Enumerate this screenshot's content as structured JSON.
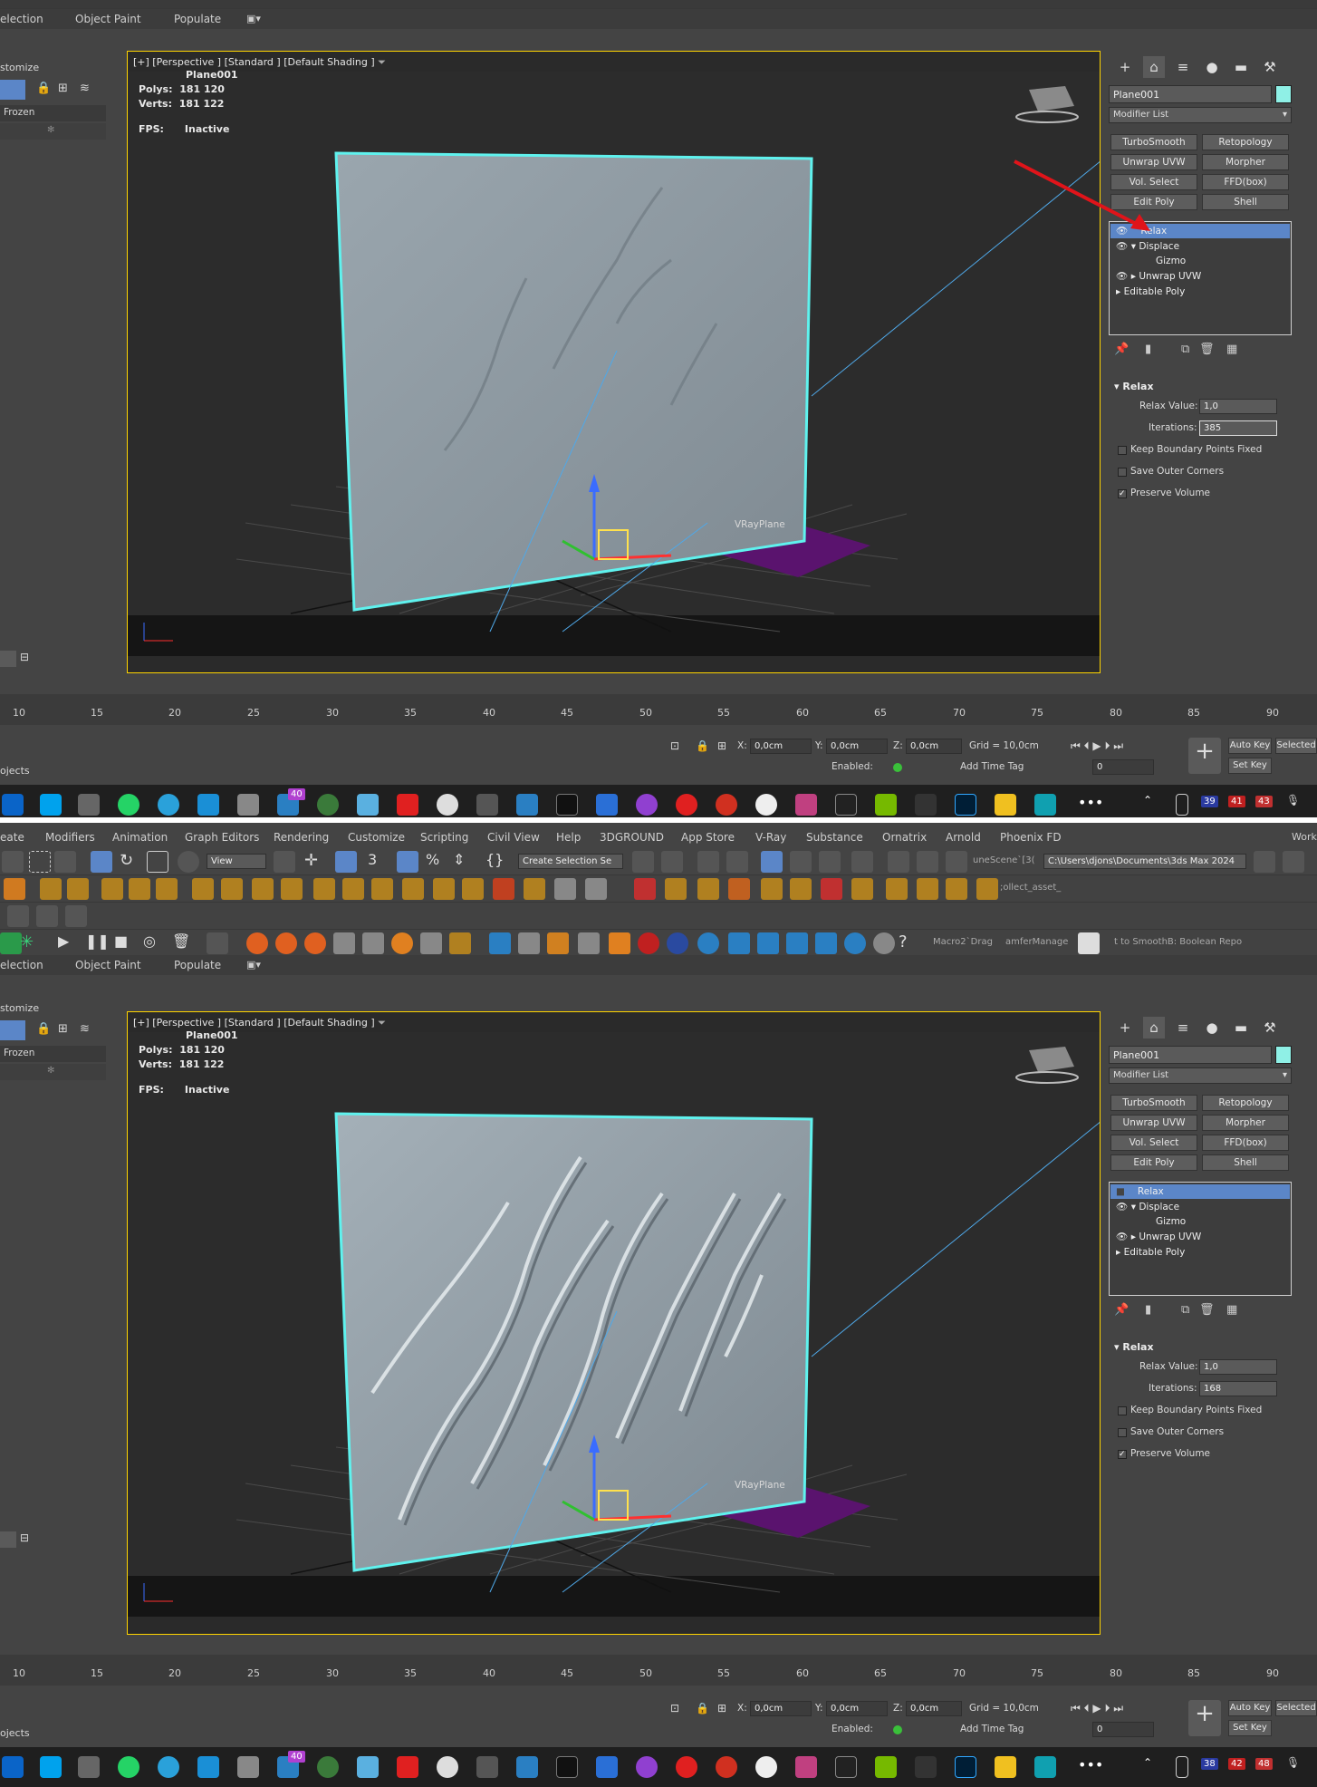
{
  "menu": [
    "eate",
    "Modifiers",
    "Animation",
    "Graph Editors",
    "Rendering",
    "Customize",
    "Scripting",
    "Civil View",
    "Help",
    "3DGROUND",
    "App Store",
    "V-Ray",
    "Substance",
    "Ornatrix",
    "Arnold",
    "Phoenix FD",
    "Work"
  ],
  "toolbar": {
    "view_dropdown": "View",
    "create_selection": "Create Selection Se",
    "scene_name": "uneScene`[3(",
    "project_path": "C:\\Users\\djons\\Documents\\3ds Max 2024",
    "collect_asset": ";ollect_asset_",
    "macro_drag": "Macro2`Drag",
    "amfer": "amferManage",
    "boolean_repo": "t to SmoothB: Boolean Repo"
  },
  "selection_bar": {
    "item1": "election",
    "item2": "Object Paint",
    "item3": "Populate"
  },
  "left_panel": {
    "title": "stomize",
    "frozen": "Frozen"
  },
  "viewport": {
    "label": "[+] [Perspective ] [Standard ] [Default Shading ]",
    "object_name": "Plane001",
    "polys_label": "Polys:",
    "polys_value": "181 120",
    "verts_label": "Verts:",
    "verts_value": "181 122",
    "fps_label": "FPS:",
    "fps_value": "Inactive",
    "vray_plane": "VRayPlane"
  },
  "command_panel": {
    "object_name": "Plane001",
    "modifier_list": "Modifier List",
    "buttons": [
      "TurboSmooth",
      "Retopology",
      "Unwrap UVW",
      "Morpher",
      "Vol. Select",
      "FFD(box)",
      "Edit Poly",
      "Shell"
    ],
    "stack": [
      "Relax",
      "Displace",
      "Gizmo",
      "Unwrap UVW",
      "Editable Poly"
    ],
    "relax_title": "Relax",
    "relax_value_label": "Relax Value:",
    "relax_value": "1,0",
    "iterations_label": "Iterations:",
    "keep_boundary": "Keep Boundary Points Fixed",
    "save_outer": "Save Outer Corners",
    "preserve_volume": "Preserve Volume"
  },
  "screens": {
    "top": {
      "iterations": "385"
    },
    "bottom": {
      "iterations": "168"
    }
  },
  "timeline": [
    "10",
    "15",
    "20",
    "25",
    "30",
    "35",
    "40",
    "45",
    "50",
    "55",
    "60",
    "65",
    "70",
    "75",
    "80",
    "85",
    "90"
  ],
  "status": {
    "x_label": "X:",
    "x_value": "0,0cm",
    "y_label": "Y:",
    "y_value": "0,0cm",
    "z_label": "Z:",
    "z_value": "0,0cm",
    "grid": "Grid = 10,0cm",
    "enabled": "Enabled:",
    "add_time_tag": "Add Time Tag",
    "auto_key": "Auto Key",
    "set_key": "Set Key",
    "selected": "Selected",
    "frame": "0",
    "objects": "ojects"
  },
  "taskbar": {
    "badge_40": "40",
    "top": {
      "b1": "39",
      "b2": "41",
      "b3": "43"
    },
    "bottom": {
      "b1": "38",
      "b2": "42",
      "b3": "48"
    }
  },
  "colors": {
    "selection_cyan": "#5ff2ee",
    "viewport_border": "#ffd400",
    "active_row": "#5b86c8",
    "swatch": "#8ff0e6"
  }
}
